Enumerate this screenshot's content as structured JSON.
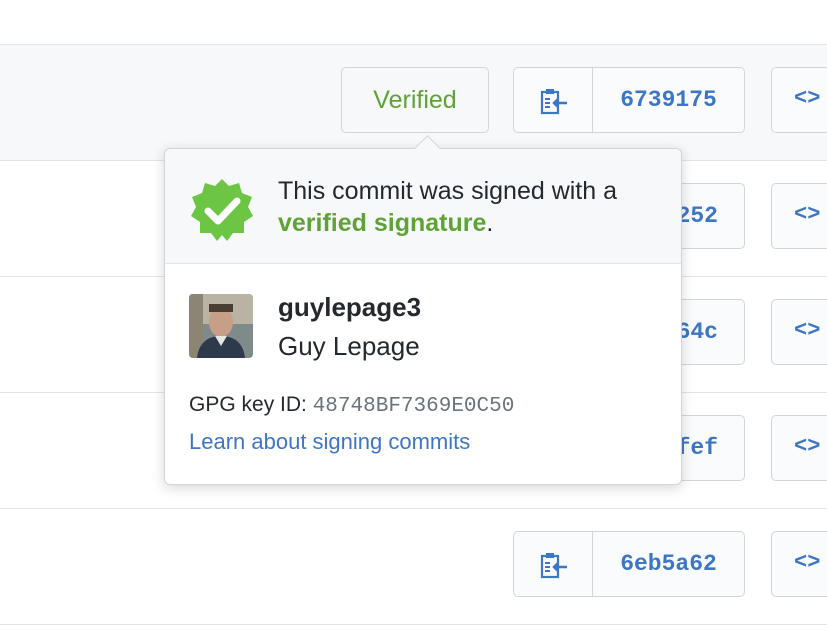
{
  "commits": [
    {
      "sha": "6739175",
      "verified_label": "Verified"
    },
    {
      "sha_partial": "252"
    },
    {
      "sha_partial": "64c"
    },
    {
      "sha_partial": "fef"
    },
    {
      "sha": "6eb5a62"
    }
  ],
  "code_button_label": "<>",
  "popover": {
    "message_prefix": "This commit was signed with a",
    "message_link": "verified signature",
    "message_suffix": ".",
    "username": "guylepage3",
    "full_name": "Guy Lepage",
    "gpg_label": "GPG key ID:",
    "gpg_key": "48748BF7369E0C50",
    "learn_link": "Learn about signing commits"
  },
  "colors": {
    "verified_green": "#5fa336",
    "link_blue": "#3d76c5",
    "border": "#d1d5da"
  },
  "icons": {
    "copy": "clipboard-icon",
    "badge": "verified-badge-icon",
    "browse": "code-icon"
  }
}
